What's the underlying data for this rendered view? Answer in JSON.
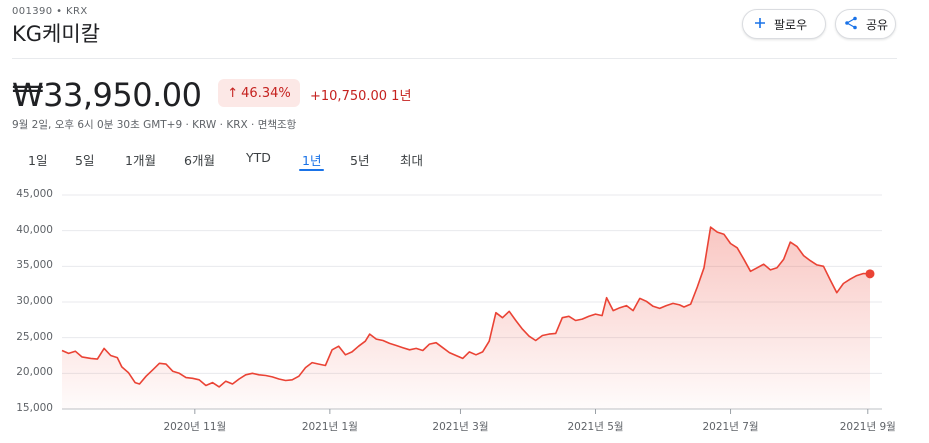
{
  "header": {
    "ticker": "001390 • KRX",
    "company": "KG케미칼",
    "follow_label": "팔로우",
    "share_label": "공유",
    "follow_icon": "plus-icon",
    "share_icon": "share-icon"
  },
  "quote": {
    "price": "₩33,950.00",
    "change_pct": "46.34%",
    "change_abs": "+10,750.00 1년",
    "meta": "9월 2일, 오후 6시 0분 30초 GMT+9 · KRW · KRX · 면책조항",
    "up_color": "#c5221f",
    "badge_bg": "#fce8e6"
  },
  "tabs": [
    "1일",
    "5일",
    "1개월",
    "6개월",
    "YTD",
    "1년",
    "5년",
    "최대"
  ],
  "active_tab": "1년",
  "chart_data": {
    "type": "area",
    "title": "",
    "xlabel": "",
    "ylabel": "",
    "ylim": [
      15000,
      45000
    ],
    "yticks": [
      15000,
      20000,
      25000,
      30000,
      35000,
      40000,
      45000
    ],
    "ytick_labels": [
      "15,000",
      "20,000",
      "25,000",
      "30,000",
      "35,000",
      "40,000",
      "45,000"
    ],
    "xticks": [
      {
        "label": "2020년 11월",
        "date": "2020-11-01"
      },
      {
        "label": "2021년 1월",
        "date": "2021-01-01"
      },
      {
        "label": "2021년 3월",
        "date": "2021-03-01"
      },
      {
        "label": "2021년 5월",
        "date": "2021-05-01"
      },
      {
        "label": "2021년 7월",
        "date": "2021-07-01"
      },
      {
        "label": "2021년 9월",
        "date": "2021-09-01"
      }
    ],
    "x_range": [
      "2020-09-02",
      "2021-09-02"
    ],
    "color": "#ea4335",
    "grid": true,
    "series": [
      {
        "points": [
          [
            "2020-09-02",
            23200
          ],
          [
            "2020-09-05",
            22800
          ],
          [
            "2020-09-08",
            23100
          ],
          [
            "2020-09-11",
            22300
          ],
          [
            "2020-09-15",
            22100
          ],
          [
            "2020-09-18",
            22000
          ],
          [
            "2020-09-21",
            23500
          ],
          [
            "2020-09-24",
            22500
          ],
          [
            "2020-09-27",
            22200
          ],
          [
            "2020-09-29",
            20900
          ],
          [
            "2020-10-02",
            20100
          ],
          [
            "2020-10-05",
            18700
          ],
          [
            "2020-10-07",
            18500
          ],
          [
            "2020-10-10",
            19600
          ],
          [
            "2020-10-13",
            20500
          ],
          [
            "2020-10-16",
            21400
          ],
          [
            "2020-10-19",
            21300
          ],
          [
            "2020-10-22",
            20300
          ],
          [
            "2020-10-25",
            20000
          ],
          [
            "2020-10-28",
            19400
          ],
          [
            "2020-10-31",
            19300
          ],
          [
            "2020-11-03",
            19100
          ],
          [
            "2020-11-06",
            18300
          ],
          [
            "2020-11-09",
            18700
          ],
          [
            "2020-11-12",
            18100
          ],
          [
            "2020-11-15",
            18900
          ],
          [
            "2020-11-18",
            18500
          ],
          [
            "2020-11-21",
            19200
          ],
          [
            "2020-11-24",
            19800
          ],
          [
            "2020-11-27",
            20000
          ],
          [
            "2020-11-30",
            19800
          ],
          [
            "2020-12-03",
            19700
          ],
          [
            "2020-12-06",
            19500
          ],
          [
            "2020-12-09",
            19200
          ],
          [
            "2020-12-12",
            19000
          ],
          [
            "2020-12-15",
            19100
          ],
          [
            "2020-12-18",
            19600
          ],
          [
            "2020-12-21",
            20800
          ],
          [
            "2020-12-24",
            21500
          ],
          [
            "2020-12-27",
            21300
          ],
          [
            "2020-12-30",
            21100
          ],
          [
            "2021-01-02",
            23300
          ],
          [
            "2021-01-05",
            23800
          ],
          [
            "2021-01-08",
            22600
          ],
          [
            "2021-01-11",
            23000
          ],
          [
            "2021-01-14",
            23800
          ],
          [
            "2021-01-17",
            24500
          ],
          [
            "2021-01-19",
            25500
          ],
          [
            "2021-01-22",
            24800
          ],
          [
            "2021-01-25",
            24600
          ],
          [
            "2021-01-28",
            24200
          ],
          [
            "2021-01-31",
            23900
          ],
          [
            "2021-02-03",
            23600
          ],
          [
            "2021-02-06",
            23300
          ],
          [
            "2021-02-09",
            23500
          ],
          [
            "2021-02-12",
            23200
          ],
          [
            "2021-02-15",
            24100
          ],
          [
            "2021-02-18",
            24300
          ],
          [
            "2021-02-21",
            23600
          ],
          [
            "2021-02-24",
            22900
          ],
          [
            "2021-02-27",
            22500
          ],
          [
            "2021-03-02",
            22100
          ],
          [
            "2021-03-05",
            23000
          ],
          [
            "2021-03-08",
            22600
          ],
          [
            "2021-03-11",
            23000
          ],
          [
            "2021-03-14",
            24500
          ],
          [
            "2021-03-17",
            28500
          ],
          [
            "2021-03-20",
            27800
          ],
          [
            "2021-03-23",
            28700
          ],
          [
            "2021-03-26",
            27400
          ],
          [
            "2021-03-29",
            26200
          ],
          [
            "2021-04-01",
            25200
          ],
          [
            "2021-04-04",
            24600
          ],
          [
            "2021-04-07",
            25300
          ],
          [
            "2021-04-10",
            25500
          ],
          [
            "2021-04-13",
            25600
          ],
          [
            "2021-04-16",
            27800
          ],
          [
            "2021-04-19",
            28000
          ],
          [
            "2021-04-22",
            27400
          ],
          [
            "2021-04-25",
            27600
          ],
          [
            "2021-04-28",
            28000
          ],
          [
            "2021-05-01",
            28300
          ],
          [
            "2021-05-04",
            28100
          ],
          [
            "2021-05-06",
            30600
          ],
          [
            "2021-05-09",
            28800
          ],
          [
            "2021-05-12",
            29200
          ],
          [
            "2021-05-15",
            29500
          ],
          [
            "2021-05-18",
            28800
          ],
          [
            "2021-05-21",
            30500
          ],
          [
            "2021-05-24",
            30100
          ],
          [
            "2021-05-27",
            29400
          ],
          [
            "2021-05-30",
            29100
          ],
          [
            "2021-06-02",
            29500
          ],
          [
            "2021-06-05",
            29800
          ],
          [
            "2021-06-08",
            29600
          ],
          [
            "2021-06-10",
            29300
          ],
          [
            "2021-06-13",
            29700
          ],
          [
            "2021-06-16",
            32100
          ],
          [
            "2021-06-19",
            34800
          ],
          [
            "2021-06-22",
            40500
          ],
          [
            "2021-06-25",
            39800
          ],
          [
            "2021-06-28",
            39500
          ],
          [
            "2021-07-01",
            38200
          ],
          [
            "2021-07-04",
            37600
          ],
          [
            "2021-07-07",
            36000
          ],
          [
            "2021-07-10",
            34300
          ],
          [
            "2021-07-13",
            34800
          ],
          [
            "2021-07-16",
            35300
          ],
          [
            "2021-07-19",
            34500
          ],
          [
            "2021-07-22",
            34800
          ],
          [
            "2021-07-25",
            36000
          ],
          [
            "2021-07-28",
            38400
          ],
          [
            "2021-07-31",
            37800
          ],
          [
            "2021-08-03",
            36500
          ],
          [
            "2021-08-06",
            35800
          ],
          [
            "2021-08-09",
            35200
          ],
          [
            "2021-08-12",
            35000
          ],
          [
            "2021-08-15",
            33100
          ],
          [
            "2021-08-18",
            31300
          ],
          [
            "2021-08-21",
            32600
          ],
          [
            "2021-08-24",
            33200
          ],
          [
            "2021-08-27",
            33700
          ],
          [
            "2021-08-30",
            34000
          ],
          [
            "2021-09-02",
            33950
          ]
        ]
      }
    ]
  }
}
